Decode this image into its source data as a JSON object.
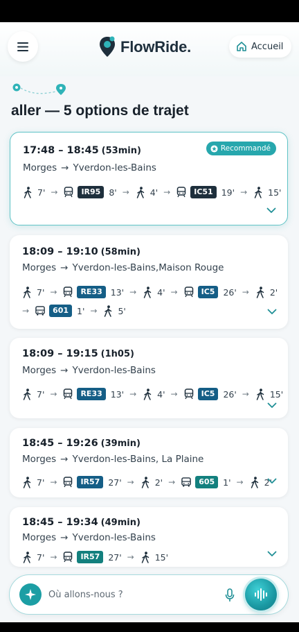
{
  "app": {
    "brand": "FlowRide.",
    "home_label": "Accueil"
  },
  "page": {
    "title": "aller — 5 options de trajet"
  },
  "colors": {
    "accent": "#27a7ad",
    "dark_badge": "#1e2f3c",
    "blue_badge": "#155e86",
    "teal_badge": "#13807e"
  },
  "recommended_label": "Recommandé",
  "trips": [
    {
      "time": "17:48 – 18:45",
      "duration": "(53min)",
      "from": "Morges",
      "to": "Yverdon-les-Bains",
      "recommended": true,
      "legs": [
        {
          "mode": "walk",
          "mins": "7'"
        },
        {
          "mode": "train",
          "line": "IR95",
          "color": "#1e2f3c",
          "mins": "8'"
        },
        {
          "mode": "walk",
          "mins": "4'"
        },
        {
          "mode": "train",
          "line": "IC51",
          "color": "#1e2f3c",
          "mins": "19'"
        },
        {
          "mode": "walk",
          "mins": "15'"
        }
      ]
    },
    {
      "time": "18:09 – 19:10",
      "duration": "(58min)",
      "from": "Morges",
      "to": "Yverdon-les-Bains,Maison Rouge",
      "legs": [
        {
          "mode": "walk",
          "mins": "7'"
        },
        {
          "mode": "train",
          "line": "RE33",
          "color": "#155e86",
          "mins": "13'"
        },
        {
          "mode": "walk",
          "mins": "4'"
        },
        {
          "mode": "train",
          "line": "IC5",
          "color": "#155e86",
          "mins": "26'"
        },
        {
          "mode": "walk",
          "mins": "2'"
        },
        {
          "mode": "bus",
          "line": "601",
          "color": "#155e86",
          "mins": "1'"
        },
        {
          "mode": "walk",
          "mins": "5'"
        }
      ]
    },
    {
      "time": "18:09 – 19:15",
      "duration": "(1h05)",
      "from": "Morges",
      "to": "Yverdon-les-Bains",
      "legs": [
        {
          "mode": "walk",
          "mins": "7'"
        },
        {
          "mode": "train",
          "line": "RE33",
          "color": "#155e86",
          "mins": "13'"
        },
        {
          "mode": "walk",
          "mins": "4'"
        },
        {
          "mode": "train",
          "line": "IC5",
          "color": "#155e86",
          "mins": "26'"
        },
        {
          "mode": "walk",
          "mins": "15'"
        }
      ]
    },
    {
      "time": "18:45 – 19:26",
      "duration": "(39min)",
      "from": "Morges",
      "to": "Yverdon-les-Bains, La Plaine",
      "legs": [
        {
          "mode": "walk",
          "mins": "7'"
        },
        {
          "mode": "train",
          "line": "IR57",
          "color": "#155e86",
          "mins": "27'"
        },
        {
          "mode": "walk",
          "mins": "2'"
        },
        {
          "mode": "bus",
          "line": "605",
          "color": "#13807e",
          "mins": "1'"
        },
        {
          "mode": "walk",
          "mins": "2'"
        }
      ]
    },
    {
      "time": "18:45 – 19:34",
      "duration": "(49min)",
      "from": "Morges",
      "to": "Yverdon-les-Bains",
      "legs": [
        {
          "mode": "walk",
          "mins": "7'"
        },
        {
          "mode": "train",
          "line": "IR57",
          "color": "#13807e",
          "mins": "27'"
        },
        {
          "mode": "walk",
          "mins": "15'"
        }
      ]
    }
  ],
  "search": {
    "placeholder": "Où allons-nous ?"
  }
}
